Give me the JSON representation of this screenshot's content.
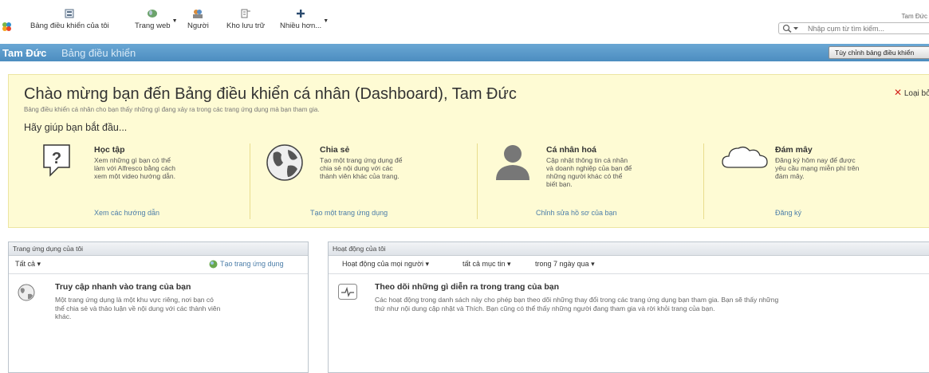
{
  "header": {
    "nav": [
      {
        "label": "Bảng điều khiển của tôi",
        "icon": "dashboard-icon"
      },
      {
        "label": "Trang web",
        "icon": "globe-icon"
      },
      {
        "label": "Người",
        "icon": "people-icon"
      },
      {
        "label": "Kho lưu trữ",
        "icon": "repository-icon"
      },
      {
        "label": "Nhiều hơn...",
        "icon": "plus-icon"
      }
    ],
    "user": "Tam Đức",
    "search_placeholder": "Nhập cụm từ tìm kiếm..."
  },
  "titlebar": {
    "owner": "Tam Đức",
    "page": "Bảng điều khiển",
    "customize_label": "Tùy chỉnh bảng điều khiển"
  },
  "welcome": {
    "title": "Chào mừng bạn đến Bảng điều khiển cá nhân (Dashboard), Tam Đức",
    "subtitle": "Bảng điều khiển cá nhân cho bạn thấy những gì đang xảy ra trong các trang ứng dụng mà bạn tham gia.",
    "start": "Hãy giúp bạn bắt đầu...",
    "remove_label": "Loại bỏ",
    "columns": [
      {
        "title": "Học tập",
        "desc": "Xem những gì bạn có thể\nlàm với Alfresco bằng cách\nxem một video hướng dẫn.",
        "link": "Xem các hướng dẫn",
        "icon": "question-icon"
      },
      {
        "title": "Chia sẻ",
        "desc": "Tạo một trang ứng dụng để\nchia sẻ nội dung với các\nthành viên khác của trang.",
        "link": "Tạo một trang ứng dụng",
        "icon": "globe-icon"
      },
      {
        "title": "Cá nhân hoá",
        "desc": "Cập nhật thông tin cá nhân\nvà doanh nghiệp của bạn để\nnhững người khác có thể\nbiết bạn.",
        "link": "Chỉnh sửa hồ sơ của bạn",
        "icon": "person-icon"
      },
      {
        "title": "Đám mây",
        "desc": "Đăng ký hôm nay để được\nyêu cầu mạng miễn phí trên\nđám mây.",
        "link": "Đăng ký",
        "icon": "cloud-icon"
      }
    ]
  },
  "sites_dashlet": {
    "title": "Trang ứng dụng của tôi",
    "filter": "Tất cả",
    "create_label": "Tạo trang ứng dụng",
    "empty_title": "Truy cập nhanh vào trang của bạn",
    "empty_desc": "Một trang ứng dụng là một khu vực riêng, nơi bạn có\nthể chia sẻ và thảo luận về nội dung với các thành viên\nkhác."
  },
  "activities_dashlet": {
    "title": "Hoạt động của tôi",
    "filters": [
      "Hoạt động của mọi người",
      "tất cả mục tin",
      "trong 7 ngày qua"
    ],
    "empty_title": "Theo dõi những gì diễn ra trong trang của bạn",
    "empty_desc": "Các hoạt động trong danh sách này cho phép bạn theo dõi những thay đổi trong các trang ứng dụng bạn tham gia. Bạn sẽ thấy những\nthứ như nội dung cập nhật và Thích. Bạn cũng có thể thấy những người đang tham gia và rời khỏi trang của bạn."
  }
}
